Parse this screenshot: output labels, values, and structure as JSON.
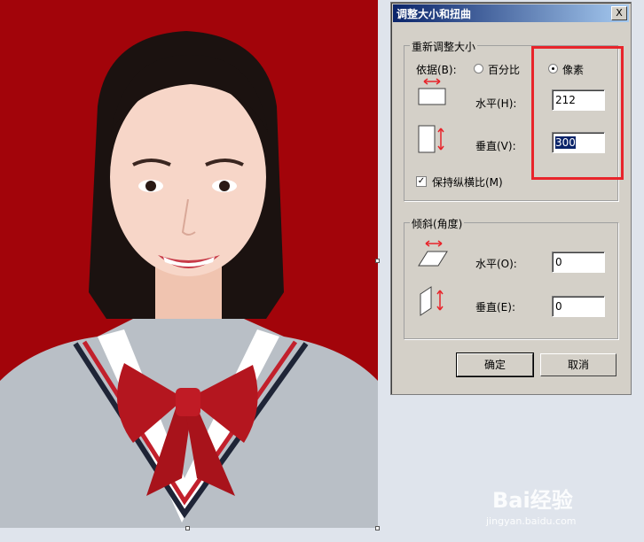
{
  "dialog": {
    "title": "调整大小和扭曲",
    "close_label": "X",
    "resize": {
      "legend": "重新调整大小",
      "by_label": "依据(B):",
      "percent_label": "百分比",
      "pixels_label": "像素",
      "horizontal_label": "水平(H):",
      "horizontal_value": "212",
      "vertical_label": "垂直(V):",
      "vertical_value": "300",
      "keep_ratio_label": "保持纵横比(M)"
    },
    "skew": {
      "legend": "倾斜(角度)",
      "horizontal_label": "水平(O):",
      "horizontal_value": "0",
      "vertical_label": "垂直(E):",
      "vertical_value": "0"
    },
    "ok_label": "确定",
    "cancel_label": "取消"
  },
  "watermark": {
    "brand": "Bai经验",
    "url": "jingyan.baidu.com"
  },
  "colors": {
    "photo_background": "#a2040a",
    "highlight_box": "#e8242b",
    "title_bar": "#0a246a"
  }
}
